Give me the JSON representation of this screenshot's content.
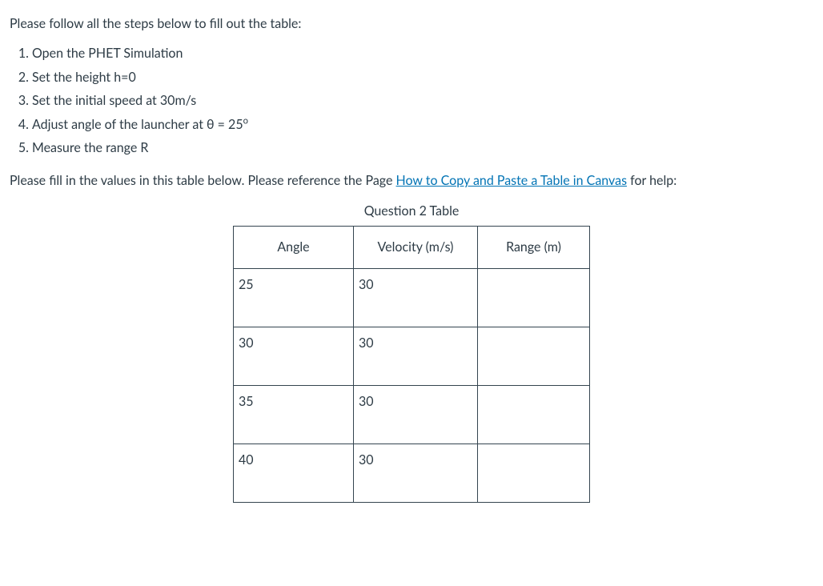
{
  "intro": "Please follow all the steps below to fill out the table:",
  "steps": [
    "Open the PHET Simulation",
    "Set the height h=0",
    "Set the initial speed at 30m/s",
    "Adjust angle of the launcher at θ = 25",
    "Measure the range R"
  ],
  "step4_degree": "o",
  "fill_pre": "Please fill in the values in this table below. Please reference the Page ",
  "link_text": "How to Copy and Paste a Table in Canvas",
  "fill_post": " for help:",
  "table": {
    "caption": "Question 2 Table",
    "headers": {
      "angle": "Angle",
      "velocity": "Velocity (m/s)",
      "range": "Range (m)"
    },
    "rows": [
      {
        "angle": "25",
        "velocity": "30",
        "range": ""
      },
      {
        "angle": "30",
        "velocity": "30",
        "range": ""
      },
      {
        "angle": "35",
        "velocity": "30",
        "range": ""
      },
      {
        "angle": "40",
        "velocity": "30",
        "range": ""
      }
    ]
  }
}
